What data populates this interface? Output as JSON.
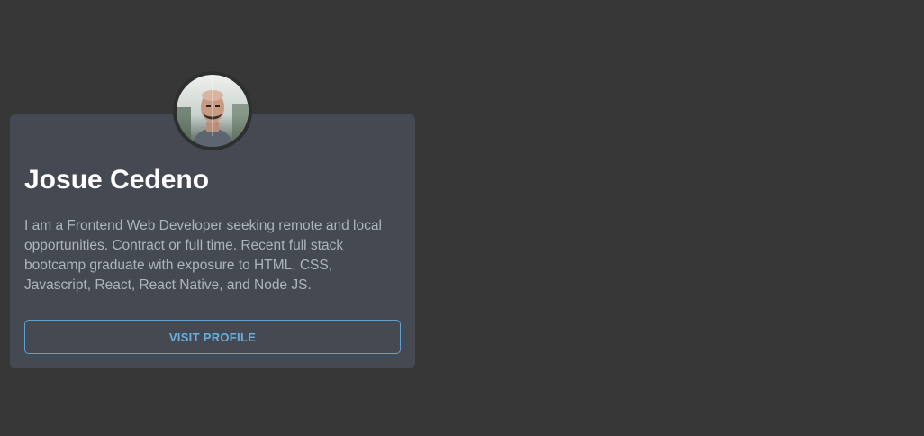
{
  "profile": {
    "name": "Josue Cedeno",
    "bio": "I am a Frontend Web Developer seeking remote and local opportunities. Contract or full time. Recent full stack bootcamp graduate with exposure to HTML, CSS, Javascript, React, React Native, and Node JS.",
    "button_label": "VISIT PROFILE"
  },
  "colors": {
    "background": "#363736",
    "card": "#454a52",
    "name": "#ffffff",
    "bio": "#aeb4bd",
    "accent": "#6aaee0"
  }
}
